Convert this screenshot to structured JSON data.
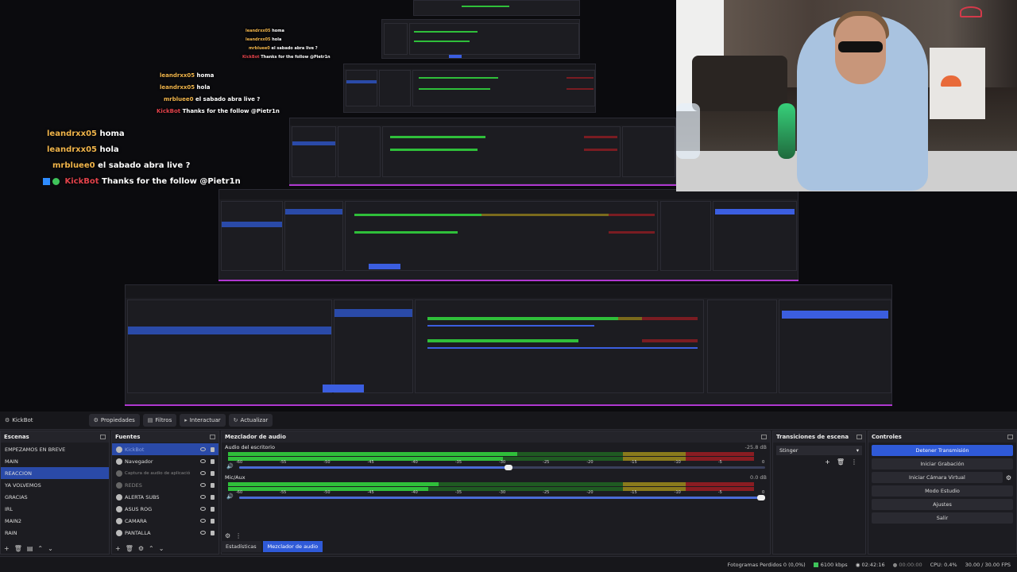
{
  "chat_overlay": {
    "large": [
      {
        "user": "leandrxx05",
        "message": "homa"
      },
      {
        "user": "leandrxx05",
        "message": "hola"
      },
      {
        "user": "mrbluee0",
        "message": "el sabado abra live ?"
      },
      {
        "user": "KickBot",
        "message": "Thanks for the follow @Pietr1n"
      }
    ]
  },
  "obs": {
    "toolbar": {
      "source_name": "KickBot",
      "properties": "Propiedades",
      "filters": "Filtros",
      "interact": "Interactuar",
      "refresh": "Actualizar"
    },
    "scenes": {
      "title": "Escenas",
      "items": [
        "EMPEZAMOS EN BREVE",
        "MAIN",
        "REACCION",
        "YA VOLVEMOS",
        "GRACIAS",
        "IRL",
        "MAIN2",
        "RAIN"
      ],
      "selected_index": 2
    },
    "sources": {
      "title": "Fuentes",
      "items": [
        {
          "label": "KickBot",
          "selected": true,
          "dim": false
        },
        {
          "label": "Navegador",
          "selected": false,
          "dim": false
        },
        {
          "label": "Captura de audio de aplicació",
          "selected": false,
          "dim": true
        },
        {
          "label": "REDES",
          "selected": false,
          "dim": true
        },
        {
          "label": "ALERTA SUBS",
          "selected": false,
          "dim": false
        },
        {
          "label": "ASUS ROG",
          "selected": false,
          "dim": false
        },
        {
          "label": "CAMARA",
          "selected": false,
          "dim": false
        },
        {
          "label": "PANTALLA",
          "selected": false,
          "dim": false
        }
      ]
    },
    "mixer": {
      "title": "Mezclador de audio",
      "channels": [
        {
          "name": "Audio del escritorio",
          "db": "-25.8 dB",
          "level": 0.55,
          "volume": 0.52
        },
        {
          "name": "Mic/Aux",
          "db": "0.0 dB",
          "level": 0.4,
          "volume": 1.0
        }
      ],
      "scale": [
        "-60",
        "-55",
        "-50",
        "-45",
        "-40",
        "-35",
        "-30",
        "-25",
        "-20",
        "-15",
        "-10",
        "-5",
        "0"
      ]
    },
    "transitions": {
      "title": "Transiciones de escena",
      "selected": "Stinger"
    },
    "controls": {
      "title": "Controles",
      "buttons": [
        {
          "label": "Detener Transmisión",
          "active": true
        },
        {
          "label": "Iniciar Grabación",
          "active": false
        },
        {
          "label": "Iniciar Cámara Virtual",
          "active": false
        },
        {
          "label": "Modo Estudio",
          "active": false
        },
        {
          "label": "Ajustes",
          "active": false
        },
        {
          "label": "Salir",
          "active": false
        }
      ]
    },
    "tabs": {
      "stats": "Estadísticas",
      "mixer": "Mezclador de audio"
    },
    "status": {
      "dropped": "Fotogramas Perdidos 0 (0,0%)",
      "bitrate": "6100 kbps",
      "live_time": "02:42:16",
      "rec_time": "00:00:00",
      "cpu": "CPU: 0.4%",
      "fps": "30.00 / 30.00 FPS"
    }
  },
  "colors": {
    "accent": "#2f5ad8",
    "meter_green": "#2fbf3a",
    "meter_yellow": "#8a7a1c",
    "meter_red": "#8a1c22",
    "frame_pink": "#b038d0"
  }
}
